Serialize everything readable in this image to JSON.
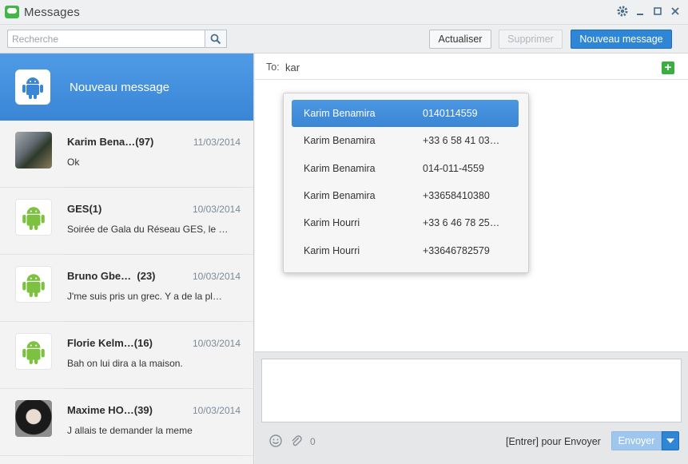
{
  "window": {
    "title": "Messages"
  },
  "toolbar": {
    "search_placeholder": "Recherche",
    "refresh_label": "Actualiser",
    "delete_label": "Supprimer",
    "new_message_label": "Nouveau message"
  },
  "sidebar": {
    "new_message_label": "Nouveau message",
    "conversations": [
      {
        "name": "Karim Bena…(97)",
        "date": "11/03/2014",
        "preview": "Ok",
        "avatar": "photo-man"
      },
      {
        "name": "GES(1)",
        "date": "10/03/2014",
        "preview": "Soirée de Gala du Réseau GES, le …",
        "avatar": "android-icon"
      },
      {
        "name": "Bruno Gbe…  (23)",
        "date": "10/03/2014",
        "preview": "J'me suis pris un grec. Y a de la pl…",
        "avatar": "android-icon"
      },
      {
        "name": "Florie Kelm…(16)",
        "date": "10/03/2014",
        "preview": "Bah on lui dira a la maison.",
        "avatar": "android-icon"
      },
      {
        "name": "Maxime HO…(39)",
        "date": "10/03/2014",
        "preview": "J allais te demander la meme",
        "avatar": "photo-woman"
      }
    ]
  },
  "compose": {
    "to_label": "To:",
    "to_value": "kar",
    "char_count": "0",
    "enter_hint": "[Entrer] pour Envoyer",
    "send_label": "Envoyer"
  },
  "suggestions": [
    {
      "name": "Karim Benamira",
      "number": "0140114559",
      "selected": true
    },
    {
      "name": "Karim Benamira",
      "number": "+33 6 58 41 03…",
      "selected": false
    },
    {
      "name": "Karim Benamira",
      "number": "014-011-4559",
      "selected": false
    },
    {
      "name": "Karim Benamira",
      "number": "+33658410380",
      "selected": false
    },
    {
      "name": "Karim Hourri",
      "number": "+33 6 46 78 25…",
      "selected": false
    },
    {
      "name": "Karim Hourri",
      "number": "+33646782579",
      "selected": false
    }
  ],
  "colors": {
    "accent": "#2f86d6",
    "add_green": "#3cae3f",
    "android_green": "#7cc240"
  }
}
